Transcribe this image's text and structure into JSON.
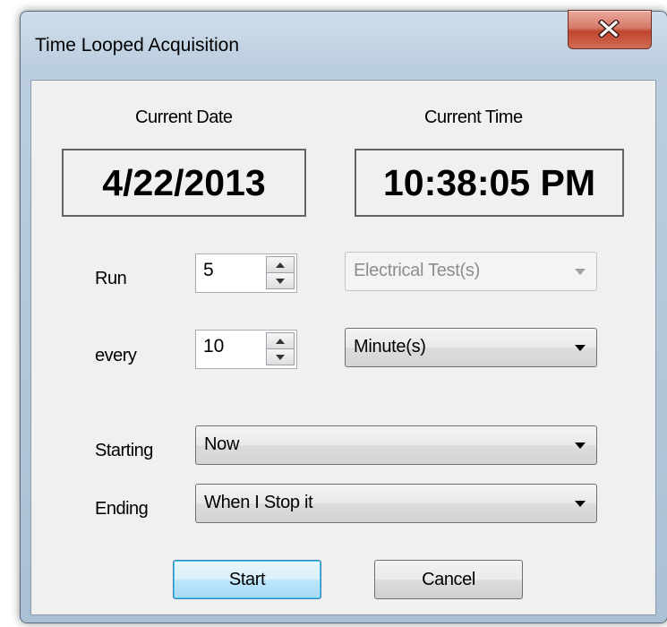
{
  "window": {
    "title": "Time Looped Acquisition"
  },
  "date_panel": {
    "label": "Current Date",
    "value": "4/22/2013"
  },
  "time_panel": {
    "label": "Current Time",
    "value": "10:38:05 PM"
  },
  "run": {
    "label": "Run",
    "count": "5",
    "type": "Electrical Test(s)"
  },
  "every": {
    "label": "every",
    "interval": "10",
    "unit": "Minute(s)"
  },
  "starting": {
    "label": "Starting",
    "value": "Now"
  },
  "ending": {
    "label": "Ending",
    "value": "When I Stop it"
  },
  "buttons": {
    "start": "Start",
    "cancel": "Cancel"
  }
}
